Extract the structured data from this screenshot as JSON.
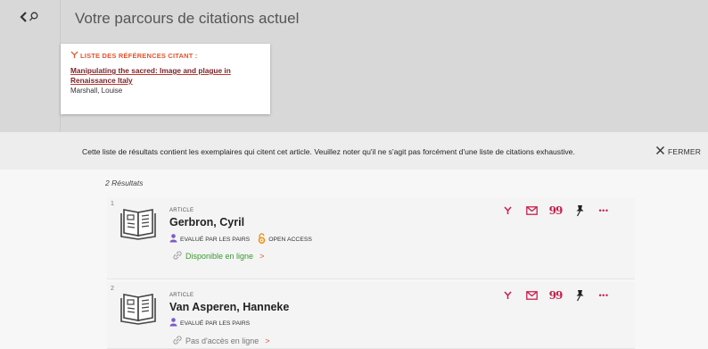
{
  "header": {
    "title": "Votre parcours de citations actuel"
  },
  "source_card": {
    "heading": "LISTE DES RÉFÉRENCES CITANT :",
    "title": "Manipulating the sacred: Image and plague in Renaissance Italy",
    "author": "Marshall, Louise"
  },
  "notice": {
    "text": "Cette liste de résultats contient les exemplaires qui citent cet article. Veuillez noter qu'il ne s'agit pas forcément d'une liste de citations exhaustive.",
    "close_label": "FERMER"
  },
  "results": {
    "count_label": "2 Résultats",
    "items": [
      {
        "number": "1",
        "type": "ARTICLE",
        "author": "Gerbron, Cyril",
        "peer_reviewed": "EVALUÉ PAR LES PAIRS",
        "open_access": "OPEN ACCESS",
        "availability": "Disponible en ligne",
        "arrow": ">"
      },
      {
        "number": "2",
        "type": "ARTICLE",
        "author": "Van Asperen, Hanneke",
        "peer_reviewed": "EVALUÉ PAR LES PAIRS",
        "availability": "Pas d'accès en ligne",
        "arrow": ">"
      }
    ],
    "actions": {
      "quote": "99",
      "more": "•••"
    }
  },
  "icons": {
    "back": "back-search-icon",
    "citation_trail": "citation-trail-icon",
    "email": "email-icon",
    "quote": "quote-icon",
    "pin": "pin-icon",
    "more": "more-icon",
    "close": "close-icon",
    "book": "book-icon",
    "peer_review": "peer-review-icon",
    "open_access": "open-access-lock-icon",
    "link": "link-icon"
  },
  "colors": {
    "accent": "#e0552f",
    "action": "#c7204b",
    "title_link": "#7a1f28",
    "available": "#3a9a2f",
    "peer_review": "#7b5cc4",
    "open_access": "#f08a00"
  }
}
